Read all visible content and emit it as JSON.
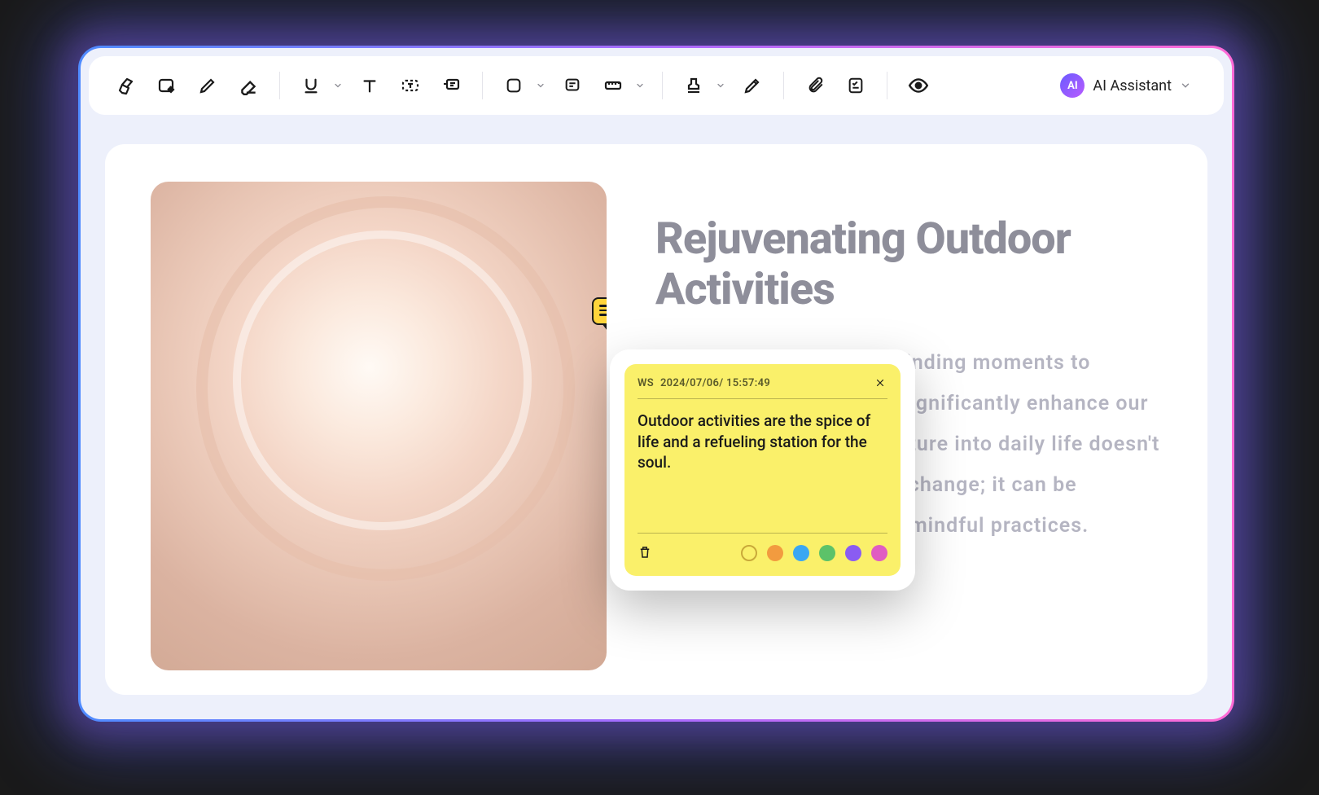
{
  "toolbar": {
    "ai_badge": "AI",
    "ai_label": "AI Assistant"
  },
  "document": {
    "title": "Rejuvenating Outdoor Activities",
    "body": "In a busy modern world, finding moments to connect with nature can significantly enhance our well-being. Integrating nature into daily life doesn't require a drastic lifestyle change; it can be achieved through simple, mindful practices."
  },
  "note": {
    "author": "WS",
    "timestamp": "2024/07/06/ 15:57:49",
    "text": "Outdoor activities are the spice of life and a refueling station for the soul."
  }
}
